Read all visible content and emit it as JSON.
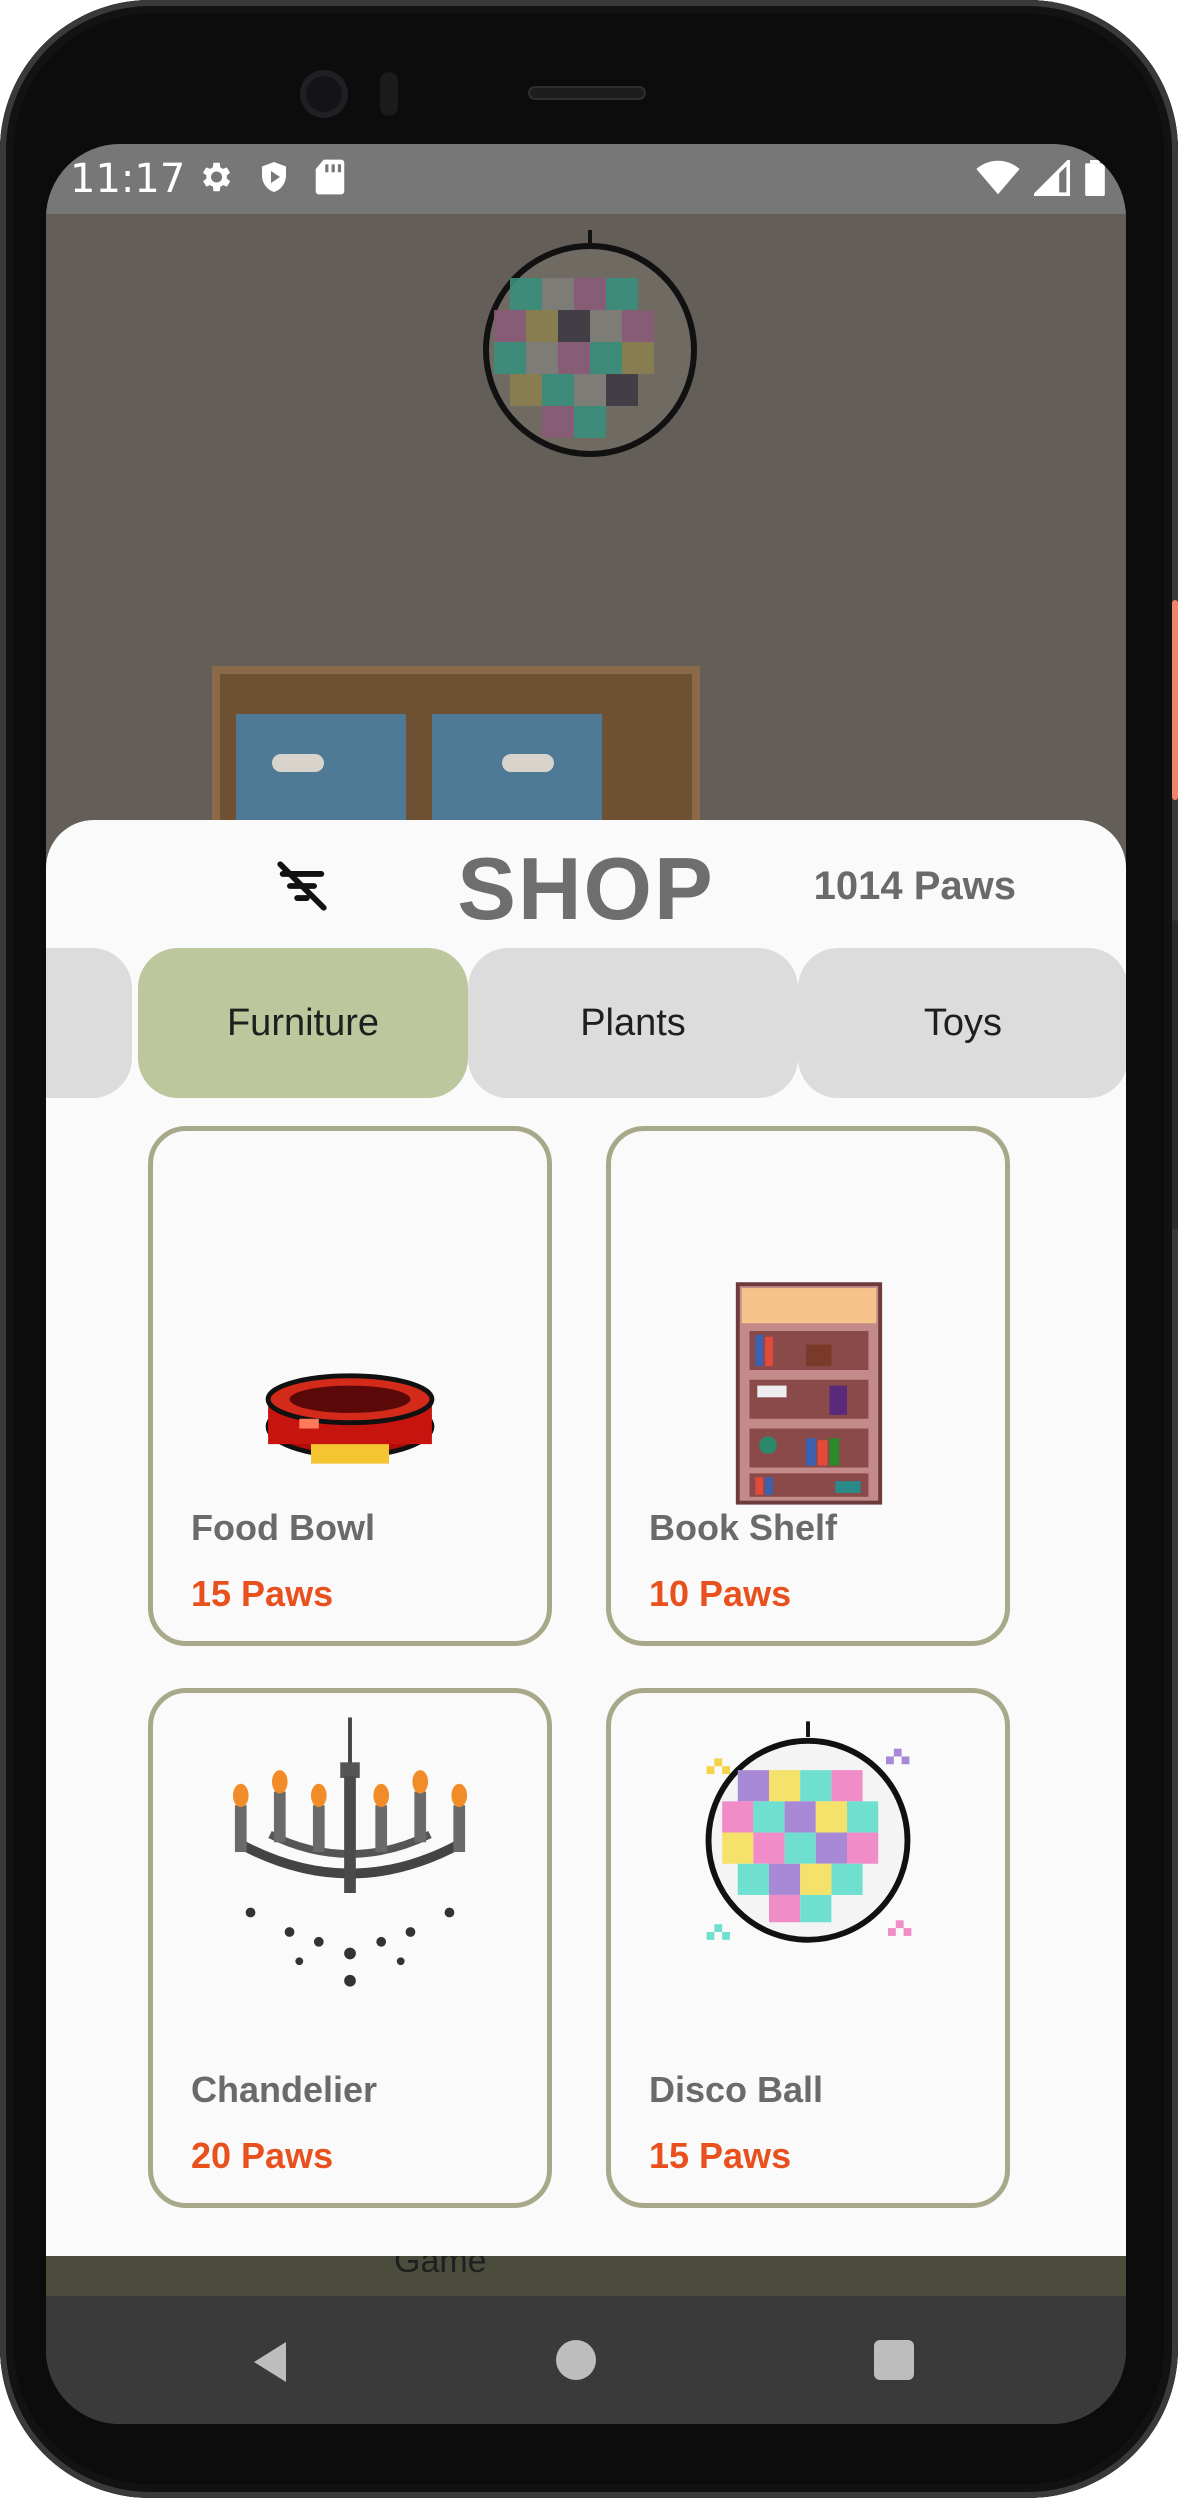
{
  "status_bar": {
    "time": "11:17",
    "icons": [
      "gear-icon",
      "shield-icon",
      "sd-card-icon",
      "wifi-icon",
      "signal-icon",
      "battery-icon"
    ]
  },
  "shop": {
    "title": "SHOP",
    "paws_balance": "1014 Paws",
    "filter_icon": "filter-off-icon"
  },
  "tabs": [
    {
      "label": "",
      "selected": false
    },
    {
      "label": "Furniture",
      "selected": true
    },
    {
      "label": "Plants",
      "selected": false
    },
    {
      "label": "Toys",
      "selected": false
    }
  ],
  "items": [
    {
      "name": "Food Bowl",
      "price": "15 Paws",
      "image": "food-bowl-icon"
    },
    {
      "name": "Book Shelf",
      "price": "10 Paws",
      "image": "book-shelf-icon"
    },
    {
      "name": "Chandelier",
      "price": "20 Paws",
      "image": "chandelier-icon"
    },
    {
      "name": "Disco Ball",
      "price": "15 Paws",
      "image": "disco-ball-icon"
    }
  ],
  "bottom_strip": {
    "label": "Game"
  },
  "colors": {
    "selected_tab": "#bcc79d",
    "price": "#e8511e",
    "card_border": "#a8a88a",
    "room_bg": "#645e58"
  },
  "nav": {
    "back": "back-icon",
    "home": "home-icon",
    "recents": "recents-icon"
  }
}
